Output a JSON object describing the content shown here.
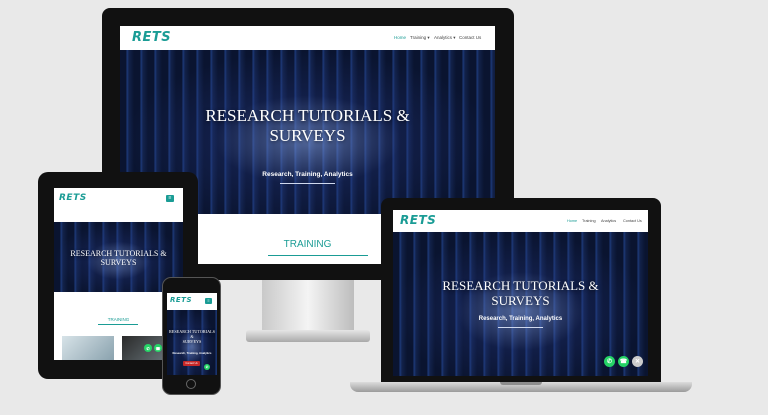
{
  "brand": "RETS",
  "nav": {
    "home": "Home",
    "training": "Training",
    "analytics": "Analytics",
    "contact": "Contact Us"
  },
  "hero": {
    "title_line1": "RESEARCH TUTORIALS &",
    "title_line2": "SURVEYS",
    "subtitle": "Research, Training, Analytics"
  },
  "section_title": "TRAINING",
  "phone_contact": "Contact Us",
  "colors": {
    "accent": "#1a9c95",
    "whatsapp": "#25d366",
    "close": "#cccccc"
  }
}
